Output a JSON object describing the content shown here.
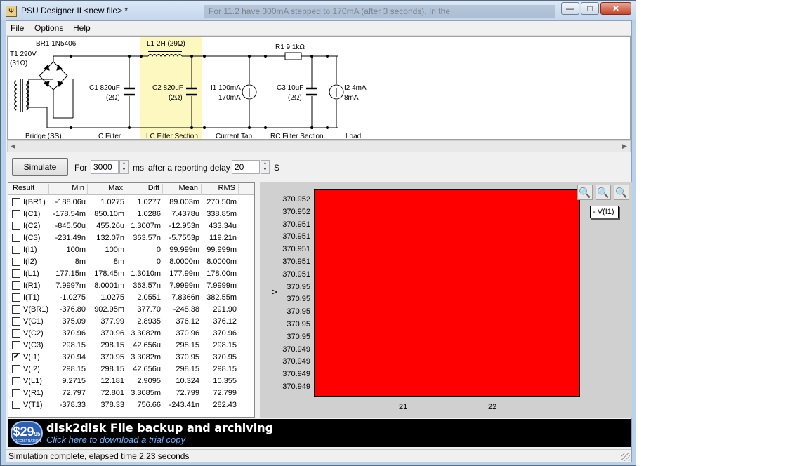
{
  "window": {
    "title": "PSU Designer II  <new file> *",
    "title_ghost": "For 11.2 have 300mA stepped to 170mA (after 3 seconds). In the",
    "minimize": "—",
    "maximize": "□",
    "close": "✕"
  },
  "menu": [
    "File",
    "Options",
    "Help"
  ],
  "schematic": {
    "br1": "BR1 1N5406",
    "t1_a": "T1 290V",
    "t1_b": "(31Ω)",
    "l1": "L1 2H (29Ω)",
    "r1": "R1 9.1kΩ",
    "c1_a": "C1 820uF",
    "c1_b": "(2Ω)",
    "c2_a": "C2 820uF",
    "c2_b": "(2Ω)",
    "i1_a": "I1 100mA",
    "i1_b": "170mA",
    "c3_a": "C3 10uF",
    "c3_b": "(2Ω)",
    "i2_a": "I2 4mA",
    "i2_b": "8mA",
    "sections": [
      "Bridge (SS)",
      "C Filter",
      "LC Filter Section",
      "Current Tap",
      "RC Filter Section",
      "Load"
    ]
  },
  "sim": {
    "button": "Simulate",
    "for_label": "For",
    "for_value": "3000",
    "ms_label": "ms",
    "delay_label": "after a reporting delay of",
    "delay_value": "20",
    "s_label": "S"
  },
  "table": {
    "headers": [
      "Result",
      "Min",
      "Max",
      "Diff",
      "Mean",
      "RMS"
    ],
    "rows": [
      {
        "checked": false,
        "name": "I(BR1)",
        "min": "-188.06u",
        "max": "1.0275",
        "diff": "1.0277",
        "mean": "89.003m",
        "rms": "270.50m"
      },
      {
        "checked": false,
        "name": "I(C1)",
        "min": "-178.54m",
        "max": "850.10m",
        "diff": "1.0286",
        "mean": "7.4378u",
        "rms": "338.85m"
      },
      {
        "checked": false,
        "name": "I(C2)",
        "min": "-845.50u",
        "max": "455.26u",
        "diff": "1.3007m",
        "mean": "-12.953n",
        "rms": "433.34u"
      },
      {
        "checked": false,
        "name": "I(C3)",
        "min": "-231.49n",
        "max": "132.07n",
        "diff": "363.57n",
        "mean": "-5.7553p",
        "rms": "119.21n"
      },
      {
        "checked": false,
        "name": "I(I1)",
        "min": "100m",
        "max": "100m",
        "diff": "0",
        "mean": "99.999m",
        "rms": "99.999m"
      },
      {
        "checked": false,
        "name": "I(I2)",
        "min": "8m",
        "max": "8m",
        "diff": "0",
        "mean": "8.0000m",
        "rms": "8.0000m"
      },
      {
        "checked": false,
        "name": "I(L1)",
        "min": "177.15m",
        "max": "178.45m",
        "diff": "1.3010m",
        "mean": "177.99m",
        "rms": "178.00m"
      },
      {
        "checked": false,
        "name": "I(R1)",
        "min": "7.9997m",
        "max": "8.0001m",
        "diff": "363.57n",
        "mean": "7.9999m",
        "rms": "7.9999m"
      },
      {
        "checked": false,
        "name": "I(T1)",
        "min": "-1.0275",
        "max": "1.0275",
        "diff": "2.0551",
        "mean": "7.8366n",
        "rms": "382.55m"
      },
      {
        "checked": false,
        "name": "V(BR1)",
        "min": "-376.80",
        "max": "902.95m",
        "diff": "377.70",
        "mean": "-248.38",
        "rms": "291.90"
      },
      {
        "checked": false,
        "name": "V(C1)",
        "min": "375.09",
        "max": "377.99",
        "diff": "2.8935",
        "mean": "376.12",
        "rms": "376.12"
      },
      {
        "checked": false,
        "name": "V(C2)",
        "min": "370.96",
        "max": "370.96",
        "diff": "3.3082m",
        "mean": "370.96",
        "rms": "370.96"
      },
      {
        "checked": false,
        "name": "V(C3)",
        "min": "298.15",
        "max": "298.15",
        "diff": "42.656u",
        "mean": "298.15",
        "rms": "298.15"
      },
      {
        "checked": true,
        "name": "V(I1)",
        "min": "370.94",
        "max": "370.95",
        "diff": "3.3082m",
        "mean": "370.95",
        "rms": "370.95"
      },
      {
        "checked": false,
        "name": "V(I2)",
        "min": "298.15",
        "max": "298.15",
        "diff": "42.656u",
        "mean": "298.15",
        "rms": "298.15"
      },
      {
        "checked": false,
        "name": "V(L1)",
        "min": "9.2715",
        "max": "12.181",
        "diff": "2.9095",
        "mean": "10.324",
        "rms": "10.355"
      },
      {
        "checked": false,
        "name": "V(R1)",
        "min": "72.797",
        "max": "72.801",
        "diff": "3.3085m",
        "mean": "72.799",
        "rms": "72.799"
      },
      {
        "checked": false,
        "name": "V(T1)",
        "min": "-378.33",
        "max": "378.33",
        "diff": "756.66",
        "mean": "-243.41n",
        "rms": "282.43"
      }
    ]
  },
  "plot": {
    "yticks": [
      "370.952",
      "370.952",
      "370.951",
      "370.951",
      "370.951",
      "370.951",
      "370.951",
      "370.95",
      "370.95",
      "370.95",
      "370.95",
      "370.95",
      "370.949",
      "370.949",
      "370.949",
      "370.949"
    ],
    "xticks": [
      "21",
      "22"
    ],
    "ylabel": "V",
    "legend": "- V(I1)",
    "fill_color": "#ff0000"
  },
  "chart_data": {
    "type": "area",
    "title": "",
    "xlabel": "",
    "ylabel": "V",
    "x_ticks": [
      "21",
      "22"
    ],
    "y_ticks": [
      "370.952",
      "370.952",
      "370.951",
      "370.951",
      "370.951",
      "370.951",
      "370.951",
      "370.95",
      "370.95",
      "370.95",
      "370.95",
      "370.95",
      "370.949",
      "370.949",
      "370.949",
      "370.949"
    ],
    "series": [
      {
        "name": "V(I1)",
        "color": "#ff0000"
      }
    ],
    "legend": "top-right"
  },
  "ad": {
    "price_main": "$29",
    "price_cents": "95",
    "price_note": "REGISTRATION",
    "title": "disk2disk File backup and archiving",
    "link": "Click here to download a trial copy"
  },
  "status": "Simulation complete, elapsed time 2.23 seconds"
}
